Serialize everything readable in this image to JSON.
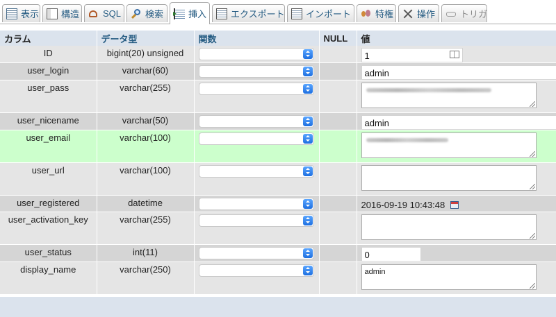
{
  "tabs": [
    {
      "id": "browse",
      "label": "表示",
      "icon": "browse-icon"
    },
    {
      "id": "structure",
      "label": "構造",
      "icon": "structure-icon"
    },
    {
      "id": "sql",
      "label": "SQL",
      "icon": "sql-icon"
    },
    {
      "id": "search",
      "label": "検索",
      "icon": "search-icon"
    },
    {
      "id": "insert",
      "label": "挿入",
      "icon": "insert-icon",
      "active": true
    },
    {
      "id": "export",
      "label": "エクスポート",
      "icon": "export-icon"
    },
    {
      "id": "import",
      "label": "インポート",
      "icon": "import-icon"
    },
    {
      "id": "privileges",
      "label": "特権",
      "icon": "privileges-icon"
    },
    {
      "id": "operations",
      "label": "操作",
      "icon": "operations-icon"
    },
    {
      "id": "triggers",
      "label": "トリガ",
      "icon": "triggers-icon",
      "disabled": true
    }
  ],
  "table": {
    "headers": {
      "column": "カラム",
      "type": "データ型",
      "function": "関数",
      "null": "NULL",
      "value": "値"
    },
    "rows": [
      {
        "name": "ID",
        "type": "bigint(20) unsigned",
        "value": "1",
        "input": "id"
      },
      {
        "name": "user_login",
        "type": "varchar(60)",
        "value": "admin",
        "input": "text"
      },
      {
        "name": "user_pass",
        "type": "varchar(255)",
        "value": "",
        "input": "textarea-blur"
      },
      {
        "name": "user_nicename",
        "type": "varchar(50)",
        "value": "admin",
        "input": "text"
      },
      {
        "name": "user_email",
        "type": "varchar(100)",
        "value": "",
        "input": "textarea-blur",
        "highlight": true
      },
      {
        "name": "user_url",
        "type": "varchar(100)",
        "value": "",
        "input": "textarea"
      },
      {
        "name": "user_registered",
        "type": "datetime",
        "value": "2016-09-19 10:43:48",
        "input": "datetime"
      },
      {
        "name": "user_activation_key",
        "type": "varchar(255)",
        "value": "",
        "input": "textarea"
      },
      {
        "name": "user_status",
        "type": "int(11)",
        "value": "0",
        "input": "short"
      },
      {
        "name": "display_name",
        "type": "varchar(250)",
        "value": "admin",
        "input": "textarea"
      }
    ]
  }
}
